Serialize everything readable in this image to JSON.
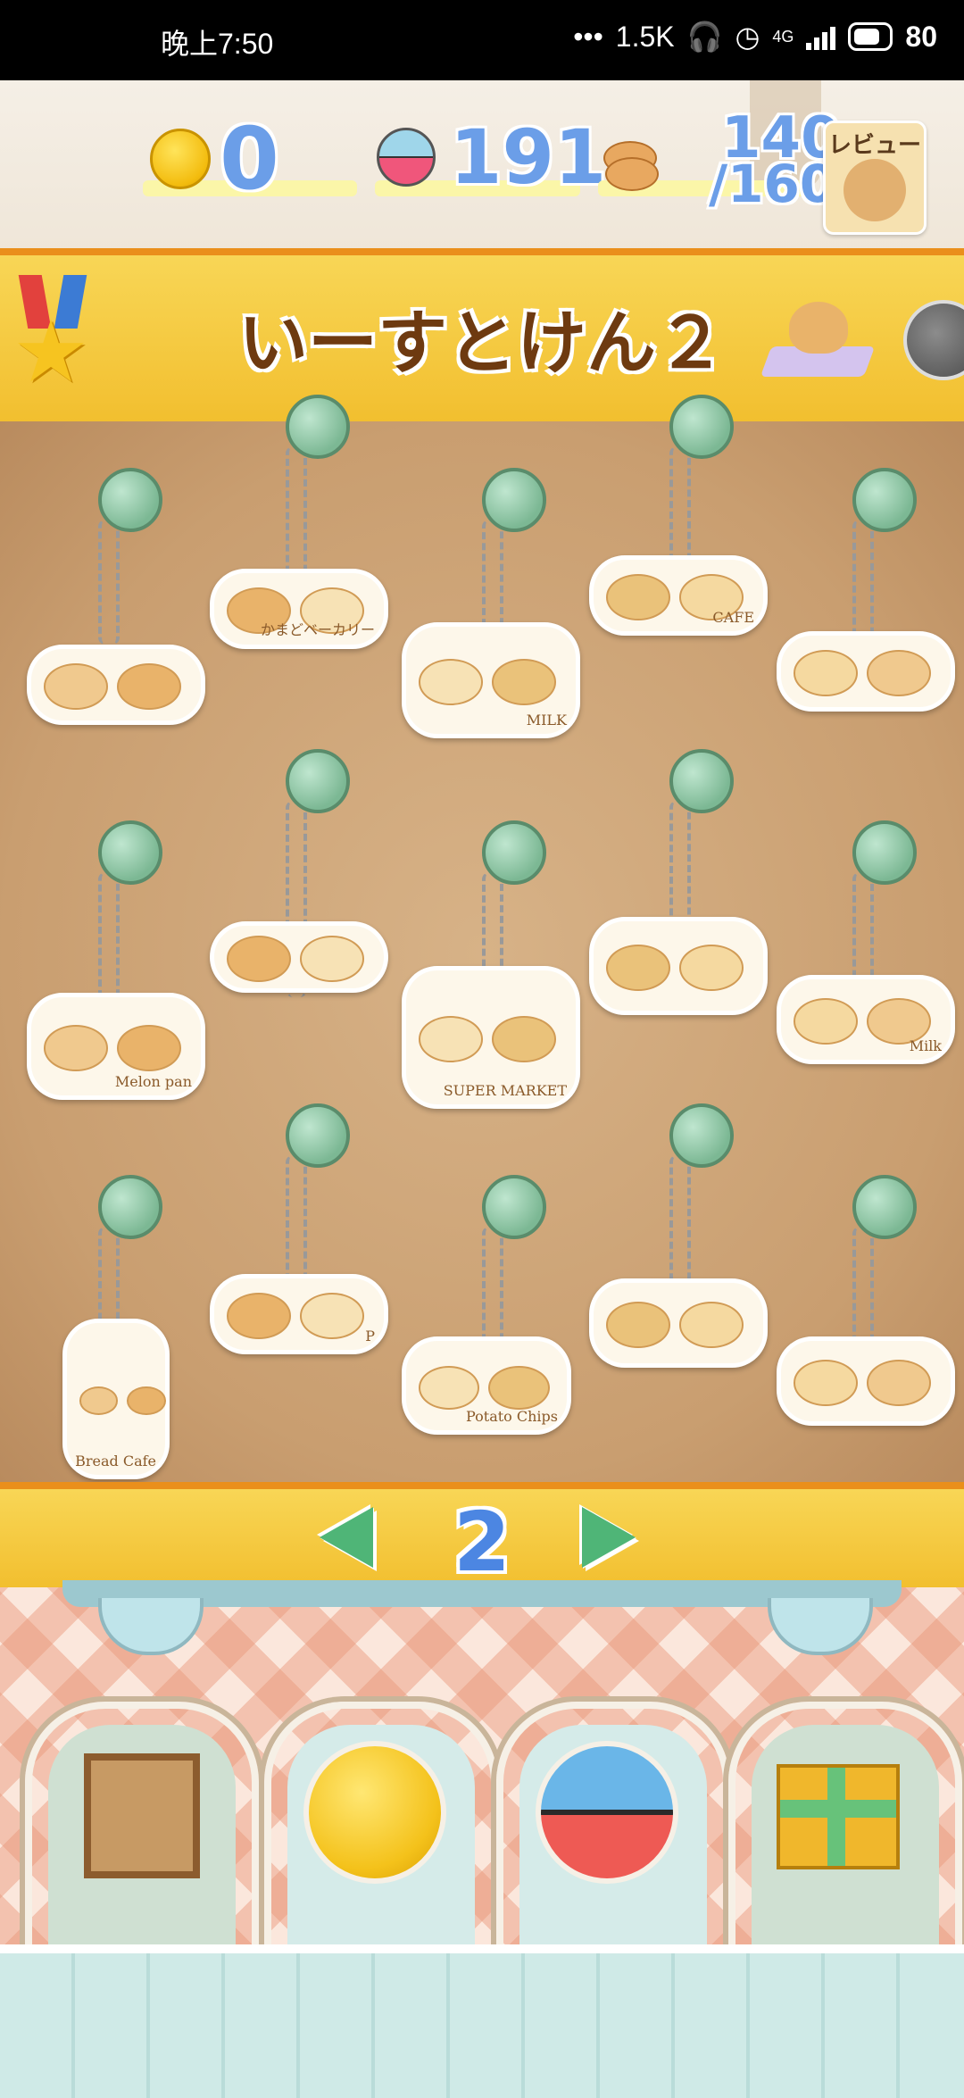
{
  "status_bar": {
    "time": "晚上7:50",
    "net_speed": "1.5K",
    "network": "4G",
    "battery": "80"
  },
  "resources": {
    "coins": "0",
    "capsules": "191",
    "bread_current": "140",
    "bread_max": "/160"
  },
  "review_button": {
    "label": "レビュー"
  },
  "banner": {
    "title": "いーすとけん２"
  },
  "board": {
    "charms": [
      {
        "name": "bread-trio"
      },
      {
        "name": "bakery-box",
        "label": "かまどベーカリー"
      },
      {
        "name": "breakfast-tray",
        "label": "MILK"
      },
      {
        "name": "bread-with-coffee",
        "label": "CAFE"
      },
      {
        "name": "bread-with-orange"
      },
      {
        "name": "melon-pan-bag",
        "label": "Melon pan"
      },
      {
        "name": "hotdog-and-bun"
      },
      {
        "name": "supermarket-bag",
        "label": "SUPER MARKET"
      },
      {
        "name": "round-bread-pile"
      },
      {
        "name": "toast-and-milk",
        "label": "Milk"
      },
      {
        "name": "baguette-bag",
        "label": "Bread Cafe"
      },
      {
        "name": "burger-and-fries",
        "label": "P"
      },
      {
        "name": "potato-chips",
        "label": "Potato Chips"
      },
      {
        "name": "salad-bowl"
      },
      {
        "name": "sandwich"
      }
    ]
  },
  "pagination": {
    "current_page": "2"
  },
  "colors": {
    "banner": "#f2bf2f",
    "banner_border": "#ea8f1b",
    "resource_number": "#6b9ee8",
    "page_number": "#4c86e2",
    "arrow": "#4fb577",
    "pin": "#7cb894"
  },
  "bottom_menu": [
    {
      "name": "frame-button"
    },
    {
      "name": "coin-button"
    },
    {
      "name": "capsule-button"
    },
    {
      "name": "gift-button"
    }
  ]
}
